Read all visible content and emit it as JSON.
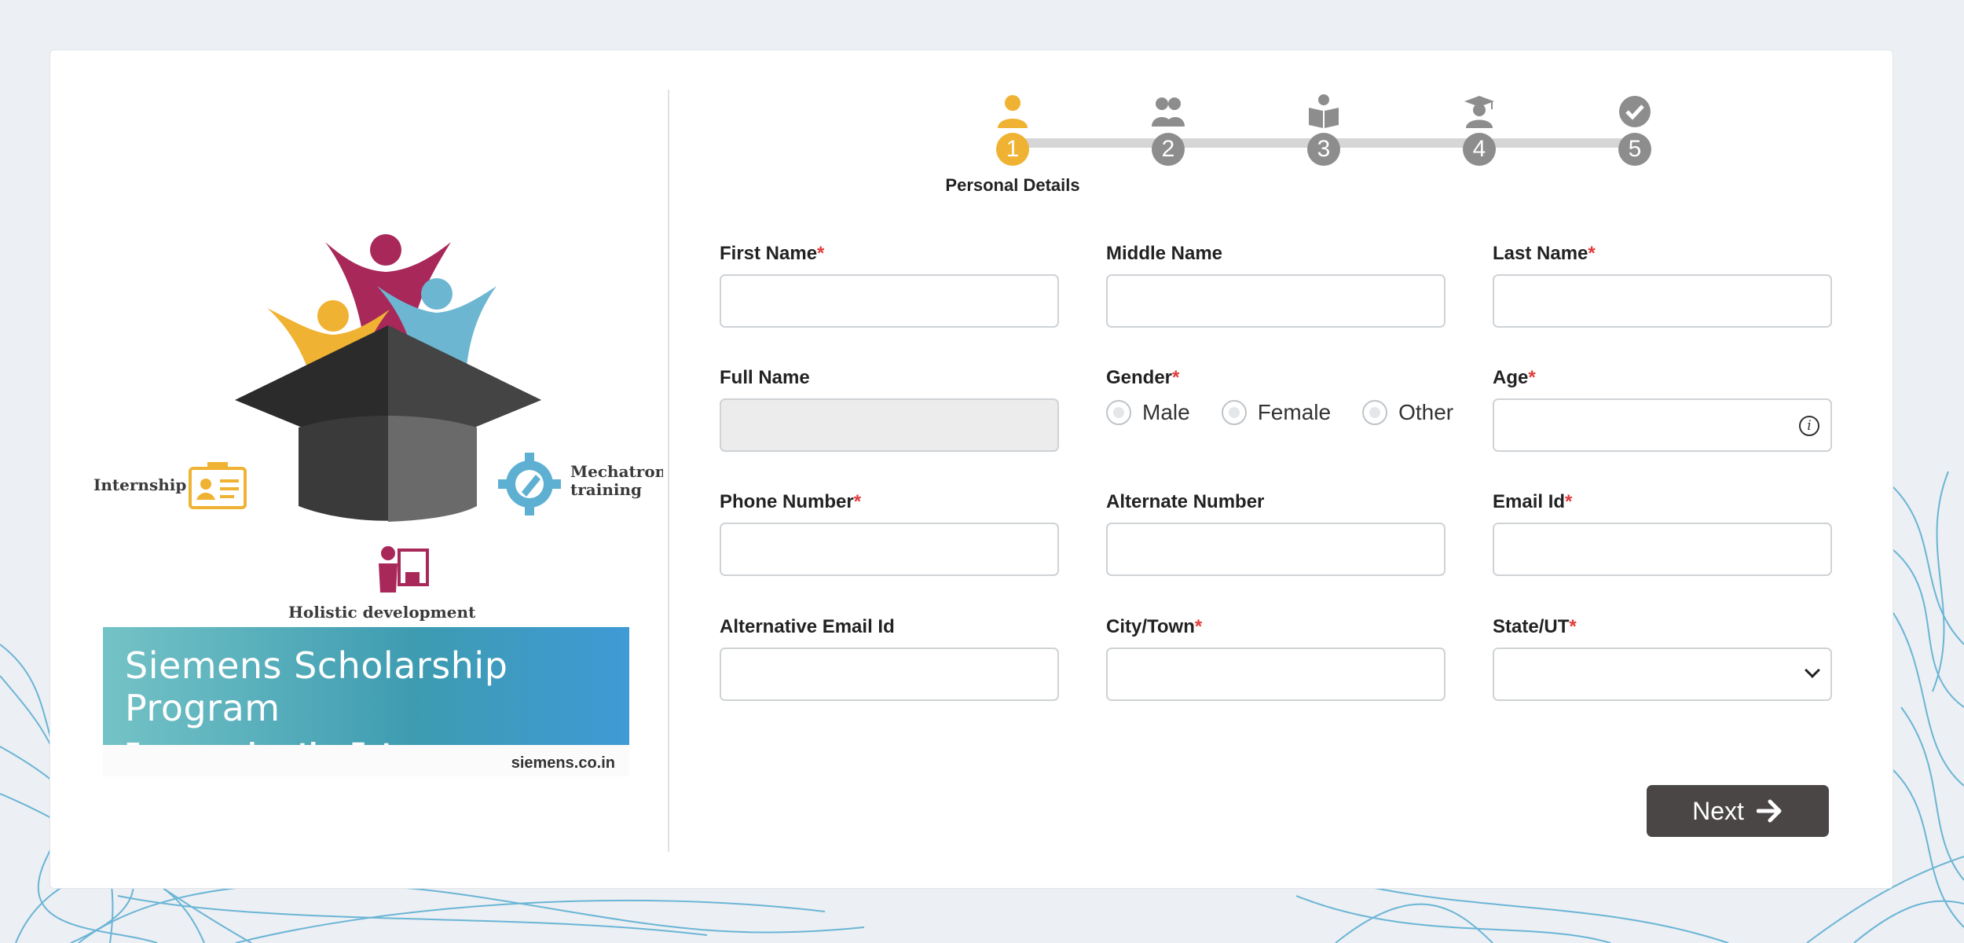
{
  "logo": {
    "labels": {
      "internship": "Internship",
      "mechatronics_line1": "Mechatronics",
      "mechatronics_line2": "training",
      "holistic": "Holistic development"
    },
    "banner_title": "Siemens Scholarship Program",
    "banner_subtitle": "Empowering the Future",
    "banner_site": "siemens.co.in"
  },
  "stepper": {
    "steps": [
      {
        "num": "1",
        "icon": "person-icon",
        "label": "Personal Details",
        "active": true
      },
      {
        "num": "2",
        "icon": "family-icon",
        "label": ""
      },
      {
        "num": "3",
        "icon": "reader-icon",
        "label": ""
      },
      {
        "num": "4",
        "icon": "graduate-icon",
        "label": ""
      },
      {
        "num": "5",
        "icon": "check-circle-icon",
        "label": ""
      }
    ]
  },
  "form": {
    "first_name": {
      "label": "First Name",
      "required": "*",
      "value": ""
    },
    "middle_name": {
      "label": "Middle Name",
      "value": ""
    },
    "last_name": {
      "label": "Last Name",
      "required": "*",
      "value": ""
    },
    "full_name": {
      "label": "Full Name",
      "value": ""
    },
    "gender": {
      "label": "Gender",
      "required": "*",
      "options": [
        "Male",
        "Female",
        "Other"
      ]
    },
    "age": {
      "label": "Age",
      "required": "*",
      "value": "",
      "info": "i"
    },
    "phone": {
      "label": "Phone Number",
      "required": "*",
      "value": ""
    },
    "alternate_number": {
      "label": "Alternate Number",
      "value": ""
    },
    "email": {
      "label": "Email Id",
      "required": "*",
      "value": ""
    },
    "alt_email": {
      "label": "Alternative Email Id",
      "value": ""
    },
    "city": {
      "label": "City/Town",
      "required": "*",
      "value": ""
    },
    "state": {
      "label": "State/UT",
      "required": "*",
      "value": ""
    }
  },
  "actions": {
    "next_label": "Next"
  },
  "colors": {
    "accent": "#f0b232",
    "step_inactive": "#8d8d8d",
    "required": "#e23a3a",
    "button": "#4a4646"
  }
}
